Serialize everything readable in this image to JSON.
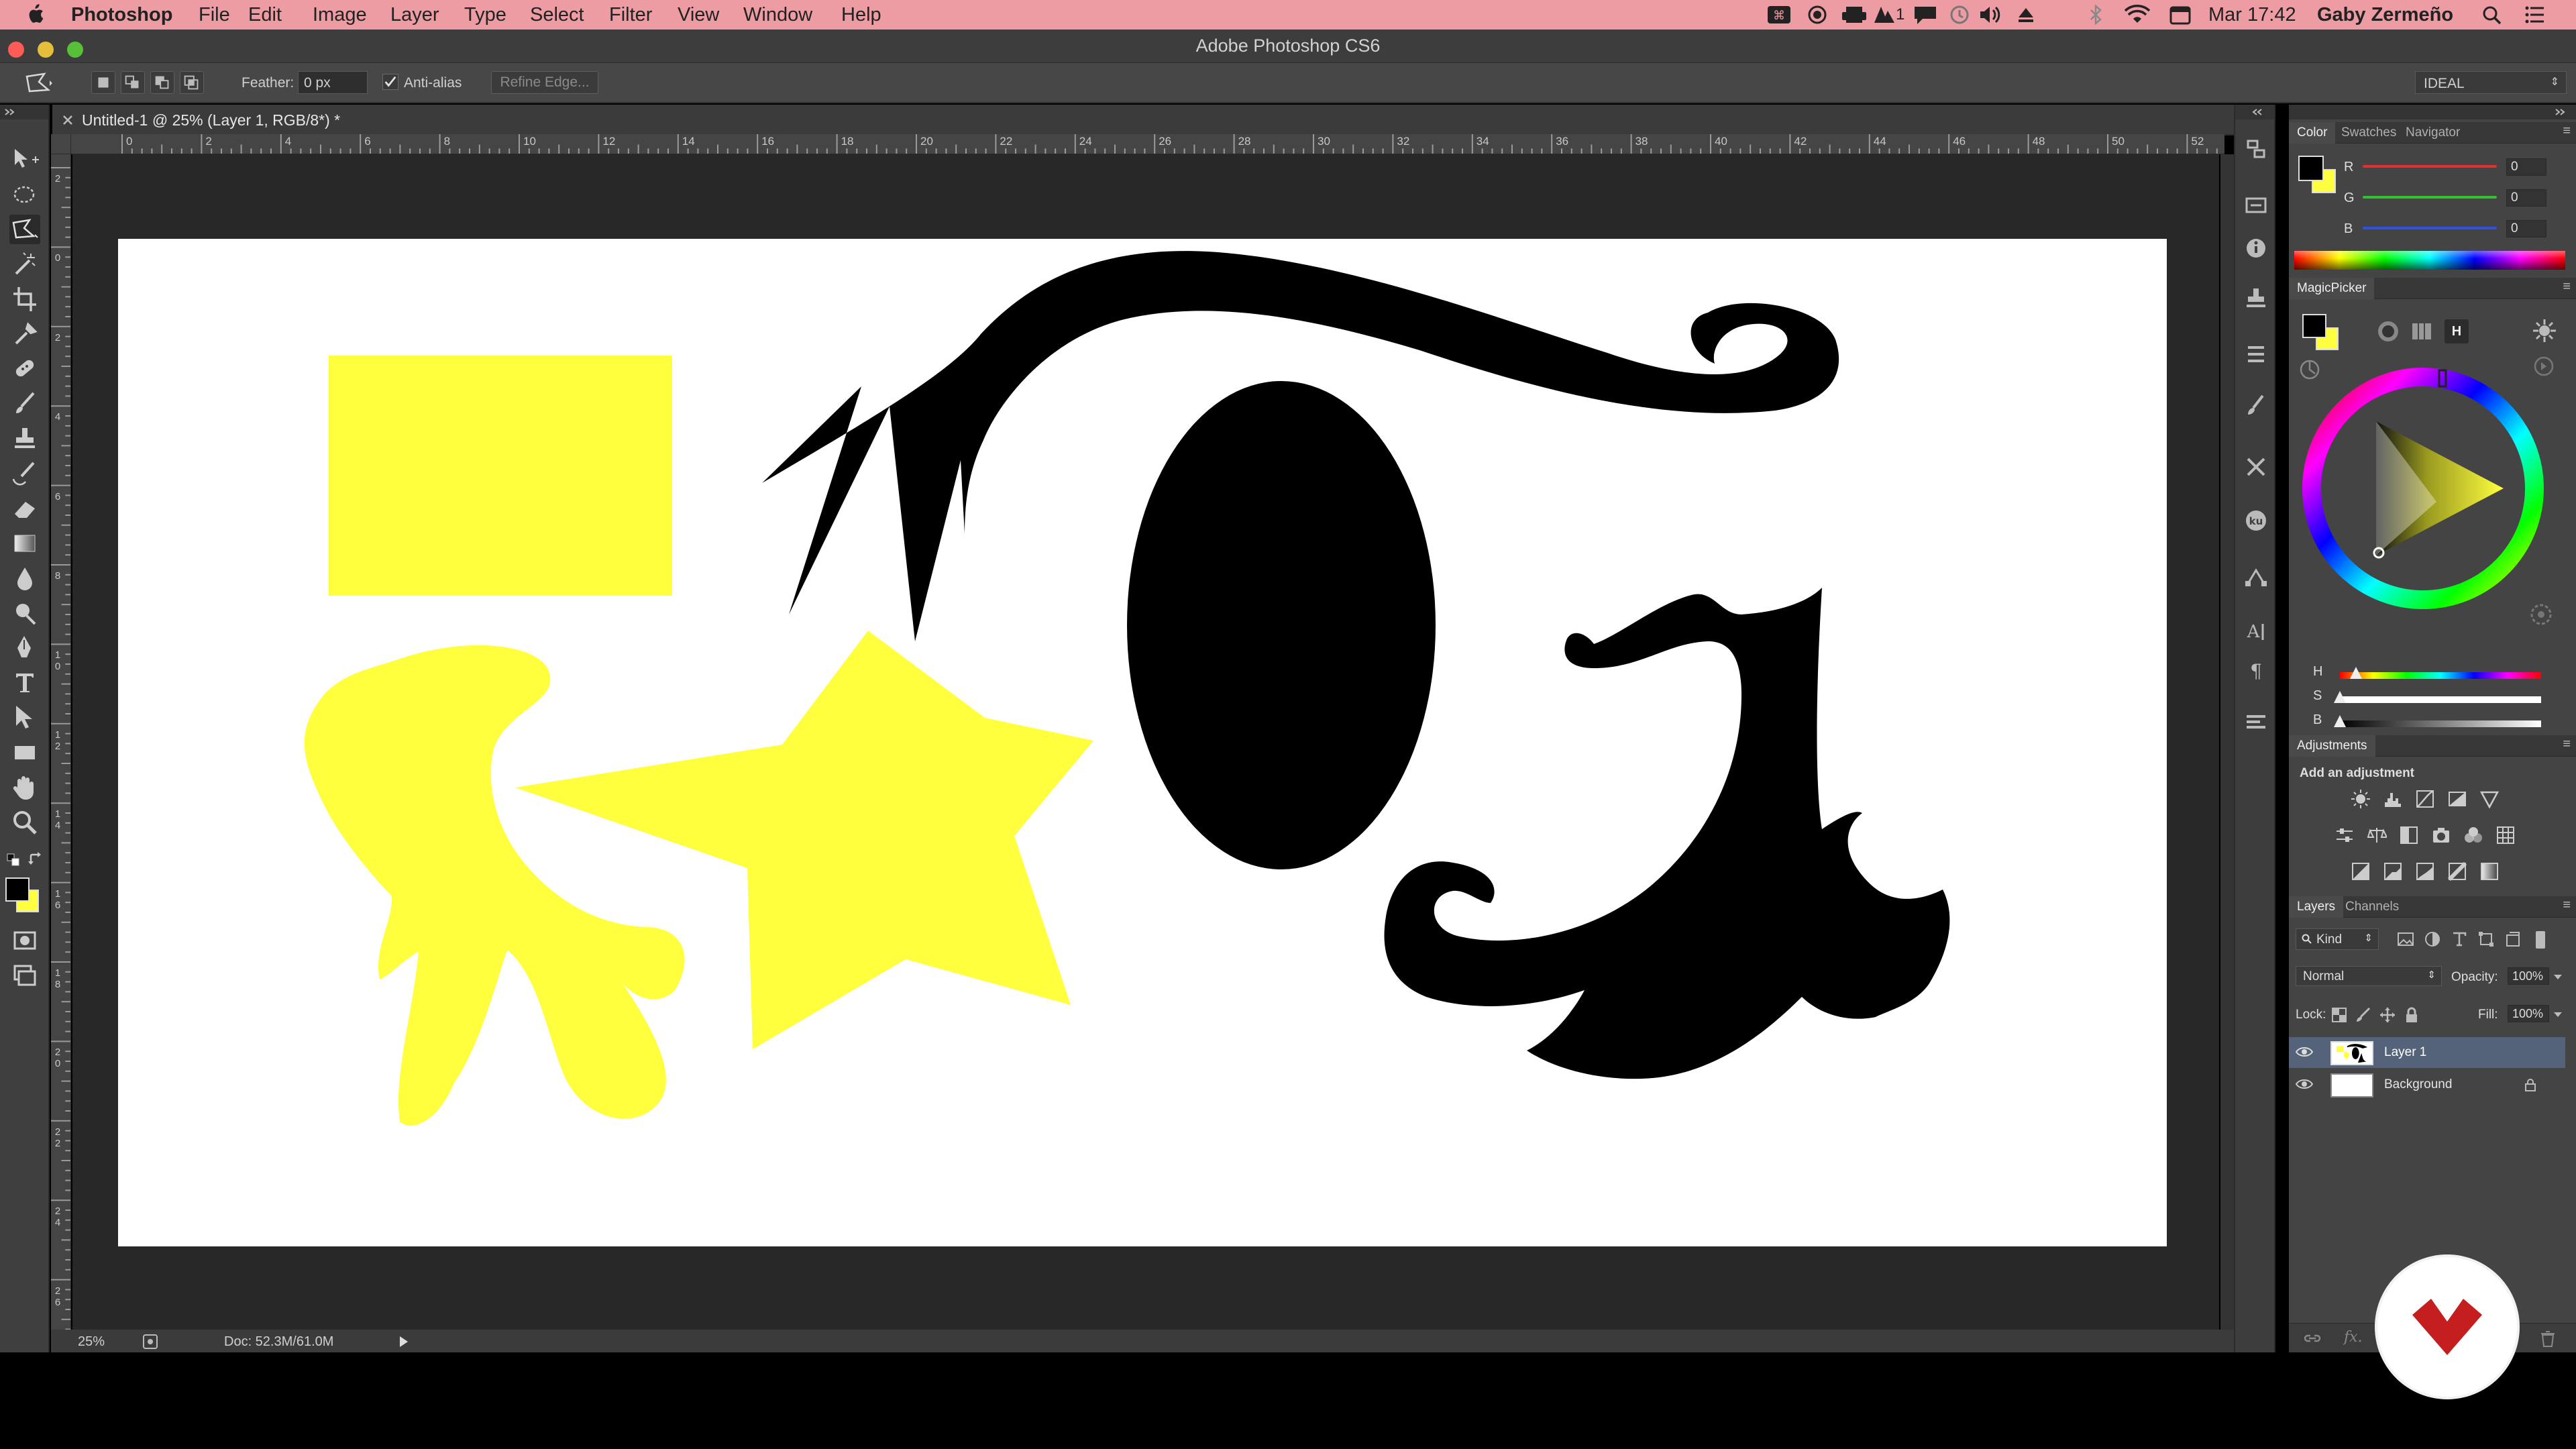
{
  "menubar": {
    "app_name": "Photoshop",
    "items": [
      "File",
      "Edit",
      "Image",
      "Layer",
      "Type",
      "Select",
      "Filter",
      "View",
      "Window",
      "Help"
    ],
    "extras_small": "1",
    "datetime": "Mar 17:42",
    "user": "Gaby Zermeño"
  },
  "window": {
    "title": "Adobe Photoshop CS6"
  },
  "options": {
    "feather_label": "Feather:",
    "feather_value": "0 px",
    "antialias_label": "Anti-alias",
    "antialias_checked": true,
    "refine_edge_label": "Refine Edge...",
    "workspace_label": "IDEAL"
  },
  "document": {
    "tab_title": "Untitled-1 @ 25% (Layer 1, RGB/8*) *",
    "ruler_h": [
      "0",
      "2",
      "4",
      "6",
      "8",
      "10",
      "12",
      "14",
      "16",
      "18",
      "20",
      "22",
      "24",
      "26",
      "28",
      "30",
      "32",
      "34",
      "36",
      "38",
      "40",
      "42",
      "44",
      "46",
      "48",
      "50",
      "52"
    ],
    "ruler_v": [
      "2",
      "0",
      "2",
      "4",
      "6",
      "8",
      "1\n0",
      "1\n2",
      "1\n4",
      "1\n6",
      "1\n8",
      "2\n0",
      "2\n2",
      "2\n4",
      "2\n6"
    ],
    "zoom": "25%",
    "doc_size": "Doc: 52.3M/61.0M"
  },
  "colors": {
    "yellow": "#ffff3e",
    "black": "#000000",
    "foreground": "#000000",
    "background": "#ffff40",
    "accent_logo": "#c41e1e"
  },
  "color_panel": {
    "tabs": [
      "Color",
      "Swatches",
      "Navigator"
    ],
    "active_tab": "Color",
    "channels": [
      {
        "label": "R",
        "value": "0",
        "color": "#e03030"
      },
      {
        "label": "G",
        "value": "0",
        "color": "#30c030"
      },
      {
        "label": "B",
        "value": "0",
        "color": "#3050e0"
      }
    ]
  },
  "magicpicker": {
    "title": "MagicPicker",
    "mode_label": "H",
    "sliders": [
      {
        "label": "H",
        "value": 0.08
      },
      {
        "label": "S",
        "value": 0.0
      },
      {
        "label": "B",
        "value": 0.0
      }
    ]
  },
  "adjustments": {
    "title": "Adjustments",
    "subtitle": "Add an adjustment"
  },
  "layers_panel": {
    "tabs": [
      "Layers",
      "Channels"
    ],
    "active_tab": "Layers",
    "kind_label": "Kind",
    "blend_mode": "Normal",
    "opacity_label": "Opacity:",
    "opacity_value": "100%",
    "lock_label": "Lock:",
    "fill_label": "Fill:",
    "fill_value": "100%",
    "layers": [
      {
        "name": "Layer 1",
        "selected": true,
        "visible": true,
        "locked": false
      },
      {
        "name": "Background",
        "selected": false,
        "visible": true,
        "locked": true
      }
    ]
  }
}
